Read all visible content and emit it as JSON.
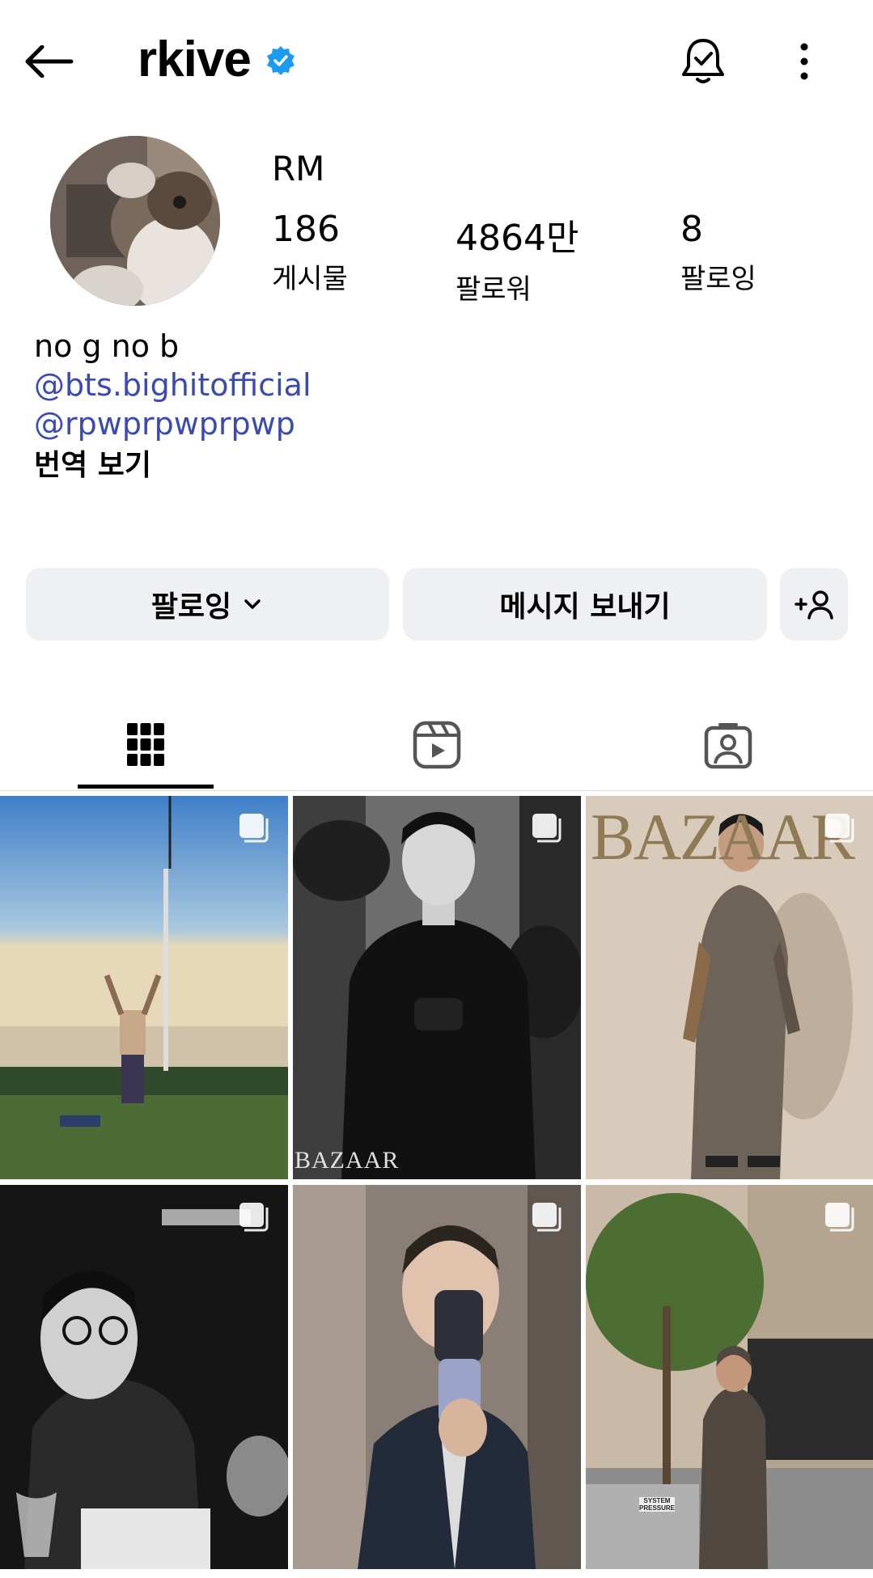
{
  "header": {
    "username": "rkive"
  },
  "profile": {
    "display_name": "RM",
    "stats": [
      {
        "value": "186",
        "label": "게시물"
      },
      {
        "value": "4864만",
        "label": "팔로워"
      },
      {
        "value": "8",
        "label": "팔로잉"
      }
    ]
  },
  "bio": {
    "text": "no g no b",
    "links": [
      "@bts.bighitofficial",
      "@rpwprpwprpwp"
    ],
    "translate": "번역 보기"
  },
  "actions": {
    "following": "팔로잉",
    "message": "메시지 보내기"
  },
  "posts": [
    {
      "overlay_text": ""
    },
    {
      "overlay_text": "BAZAAR"
    },
    {
      "overlay_text": "BAZAAR"
    },
    {
      "overlay_text": ""
    },
    {
      "overlay_text": ""
    },
    {
      "overlay_text": "SYSTEM PRESSURE"
    }
  ],
  "colors": {
    "link": "#3b4ab3",
    "verified": "#1d9bf0",
    "button_bg": "#eef0f3"
  }
}
